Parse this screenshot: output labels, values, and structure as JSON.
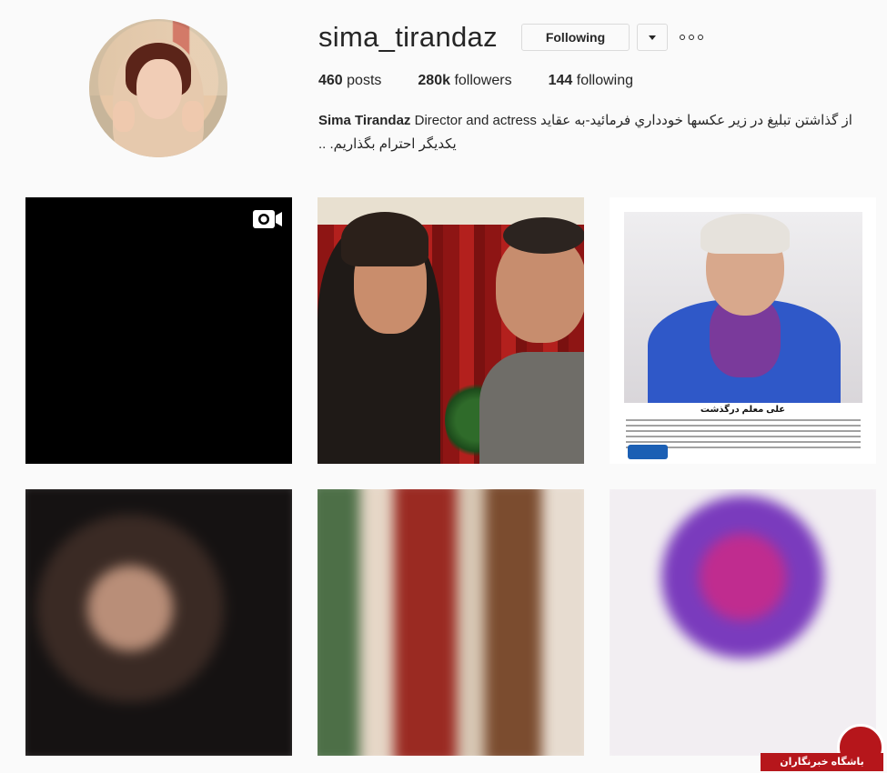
{
  "profile": {
    "username": "sima_tirandaz",
    "follow_button": "Following",
    "stats": {
      "posts_count": "460",
      "posts_label": "posts",
      "followers_count": "280k",
      "followers_label": "followers",
      "following_count": "144",
      "following_label": "following"
    },
    "bio": {
      "name": "Sima Tirandaz",
      "line1_rest": " Director and actress از گذاشتن تبليغ در زير عكسها خودداري فرمائيد-به عقايد",
      "line2": "يكديگر احترام بگذاريم. .."
    }
  },
  "posts": [
    {
      "type": "video",
      "icon": "video-camera-icon"
    },
    {
      "type": "image"
    },
    {
      "type": "image",
      "title": "علی معلم درگذشت"
    },
    {
      "type": "image"
    },
    {
      "type": "image"
    },
    {
      "type": "image"
    }
  ],
  "watermark": {
    "text": "باشگاه خبرنگاران"
  },
  "colors": {
    "accent": "#b6161b",
    "border": "#dbdbdb",
    "background": "#fafafa"
  }
}
